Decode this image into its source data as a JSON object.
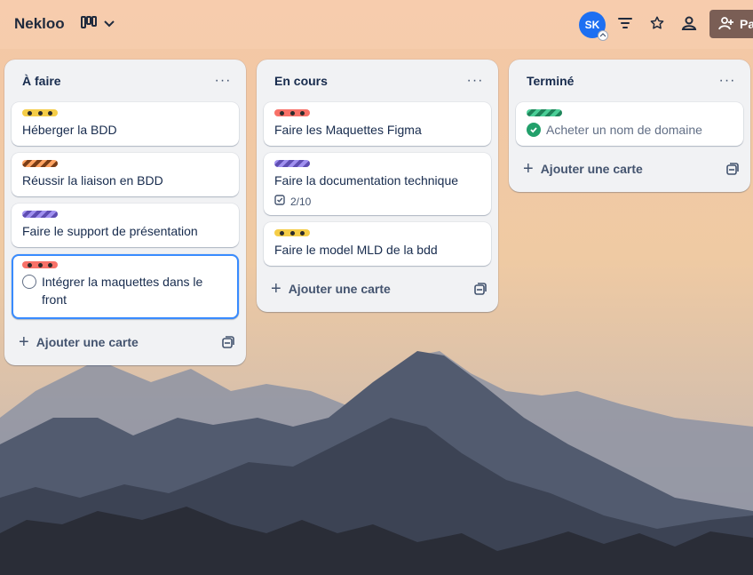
{
  "header": {
    "board_title": "Nekloo",
    "avatar_initials": "SK",
    "share_label": "Pa",
    "icons": [
      "board-view-icon",
      "chevron-down-icon",
      "filter-icon",
      "star-icon",
      "collaborators-icon",
      "add-member-icon"
    ]
  },
  "lists": [
    {
      "title": "À faire",
      "menu": "···",
      "add_label": "Ajouter une carte",
      "cards": [
        {
          "title": "Héberger la BDD",
          "label_color": "#f5cd47",
          "label_style": "dotted"
        },
        {
          "title": "Réussir la liaison en BDD",
          "label_color": "#fea362",
          "label_style": "striped-dark"
        },
        {
          "title": "Faire le support de présentation",
          "label_color": "#9f8fef",
          "label_style": "striped"
        },
        {
          "title": "Intégrer la maquettes dans le front",
          "label_color": "#f87168",
          "label_style": "dotted",
          "selected": true,
          "has_checkbox": true
        }
      ]
    },
    {
      "title": "En cours",
      "menu": "···",
      "add_label": "Ajouter une carte",
      "cards": [
        {
          "title": "Faire les Maquettes Figma",
          "label_color": "#f87168",
          "label_style": "dotted"
        },
        {
          "title": "Faire la documentation technique",
          "label_color": "#9f8fef",
          "label_style": "striped",
          "checklist": "2/10"
        },
        {
          "title": "Faire le model MLD de la bdd",
          "label_color": "#f5cd47",
          "label_style": "dotted"
        }
      ]
    },
    {
      "title": "Terminé",
      "menu": "···",
      "add_label": "Ajouter une carte",
      "cards": [
        {
          "title": "Acheter un nom de domaine",
          "label_color": "#4bce97",
          "label_style": "striped",
          "completed": true
        }
      ]
    }
  ],
  "colors": {
    "accent": "#388bff",
    "avatar": "#1d6ff2",
    "share_button": "#7a5e55",
    "done_check": "#22a06b"
  }
}
